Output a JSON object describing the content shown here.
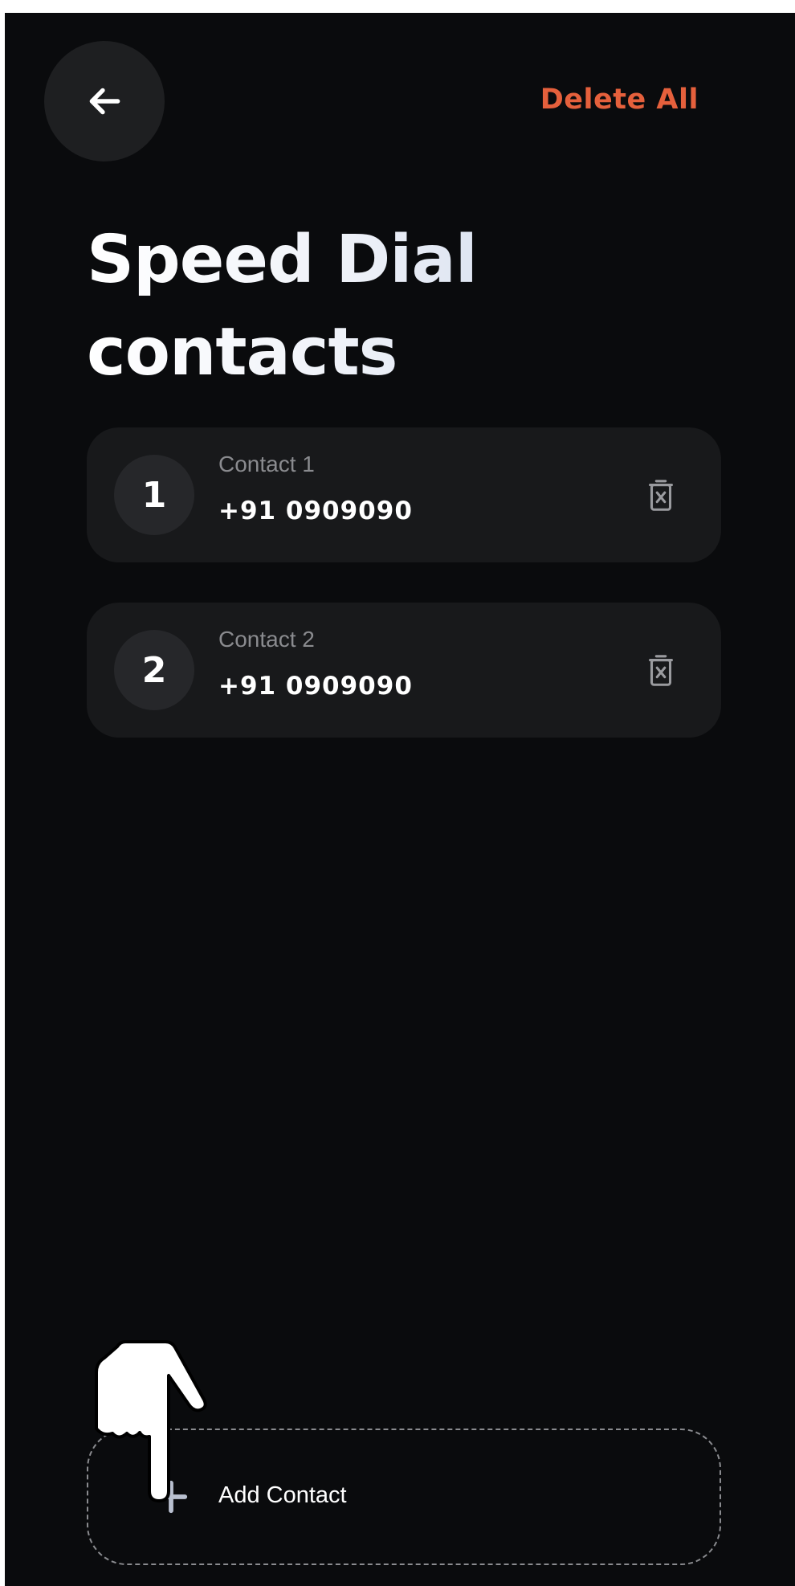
{
  "header": {
    "back_icon": "arrow-left-icon",
    "delete_all_label": "Delete All",
    "accent_color": "#e5603c"
  },
  "page": {
    "title_line1": "Speed Dial",
    "title_line2": "contacts"
  },
  "contacts": [
    {
      "index": "1",
      "name": "Contact 1",
      "number": "+91 0909090",
      "delete_icon": "trash-x-icon"
    },
    {
      "index": "2",
      "name": "Contact 2",
      "number": "+91 0909090",
      "delete_icon": "trash-x-icon"
    }
  ],
  "add_contact": {
    "icon": "plus-icon",
    "label": "Add Contact"
  },
  "overlay": {
    "cursor_icon": "pointing-hand-icon"
  }
}
